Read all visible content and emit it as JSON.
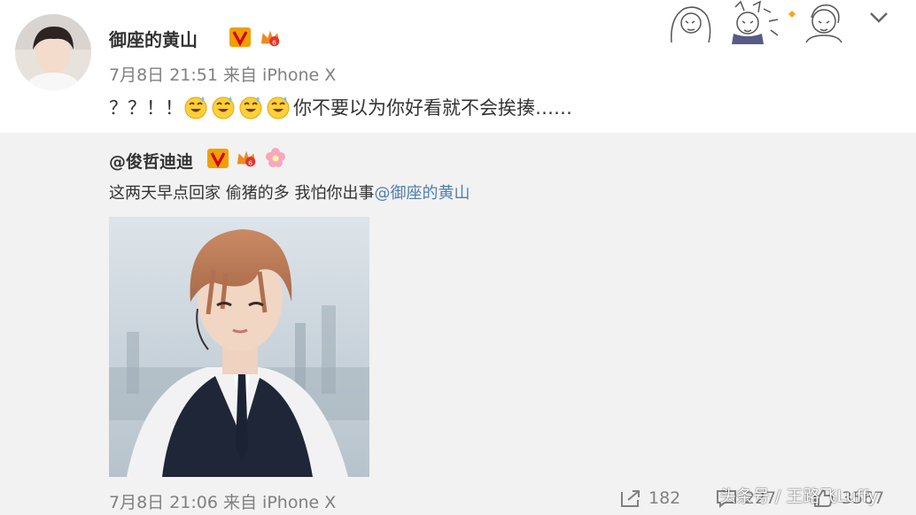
{
  "post": {
    "author": "御座的黄山",
    "meta": "7月8日 21:51 来自 iPhone X",
    "text_prefix": "？？！！",
    "emoji": [
      "smile-sweat-emoji",
      "smile-sweat-emoji",
      "smile-sweat-emoji",
      "smile-sweat-emoji"
    ],
    "text_suffix": "你不要以为你好看就不会挨揍……"
  },
  "retweet": {
    "author": "@俊哲迪迪",
    "text_main": "这两天早点回家 偷猪的多 我怕你出事",
    "mention": "@御座的黄山",
    "meta": "7月8日 21:06 来自 iPhone X",
    "repost_count": "182",
    "comment_count": "227",
    "like_count": "3567"
  },
  "watermark": "头条号 / 王路飞Luffy",
  "colors": {
    "background": "#ffffff",
    "retweet_bg": "#f2f2f2",
    "mention": "#507daf",
    "meta_gray": "#808080",
    "verified_badge": "#f0a000"
  }
}
